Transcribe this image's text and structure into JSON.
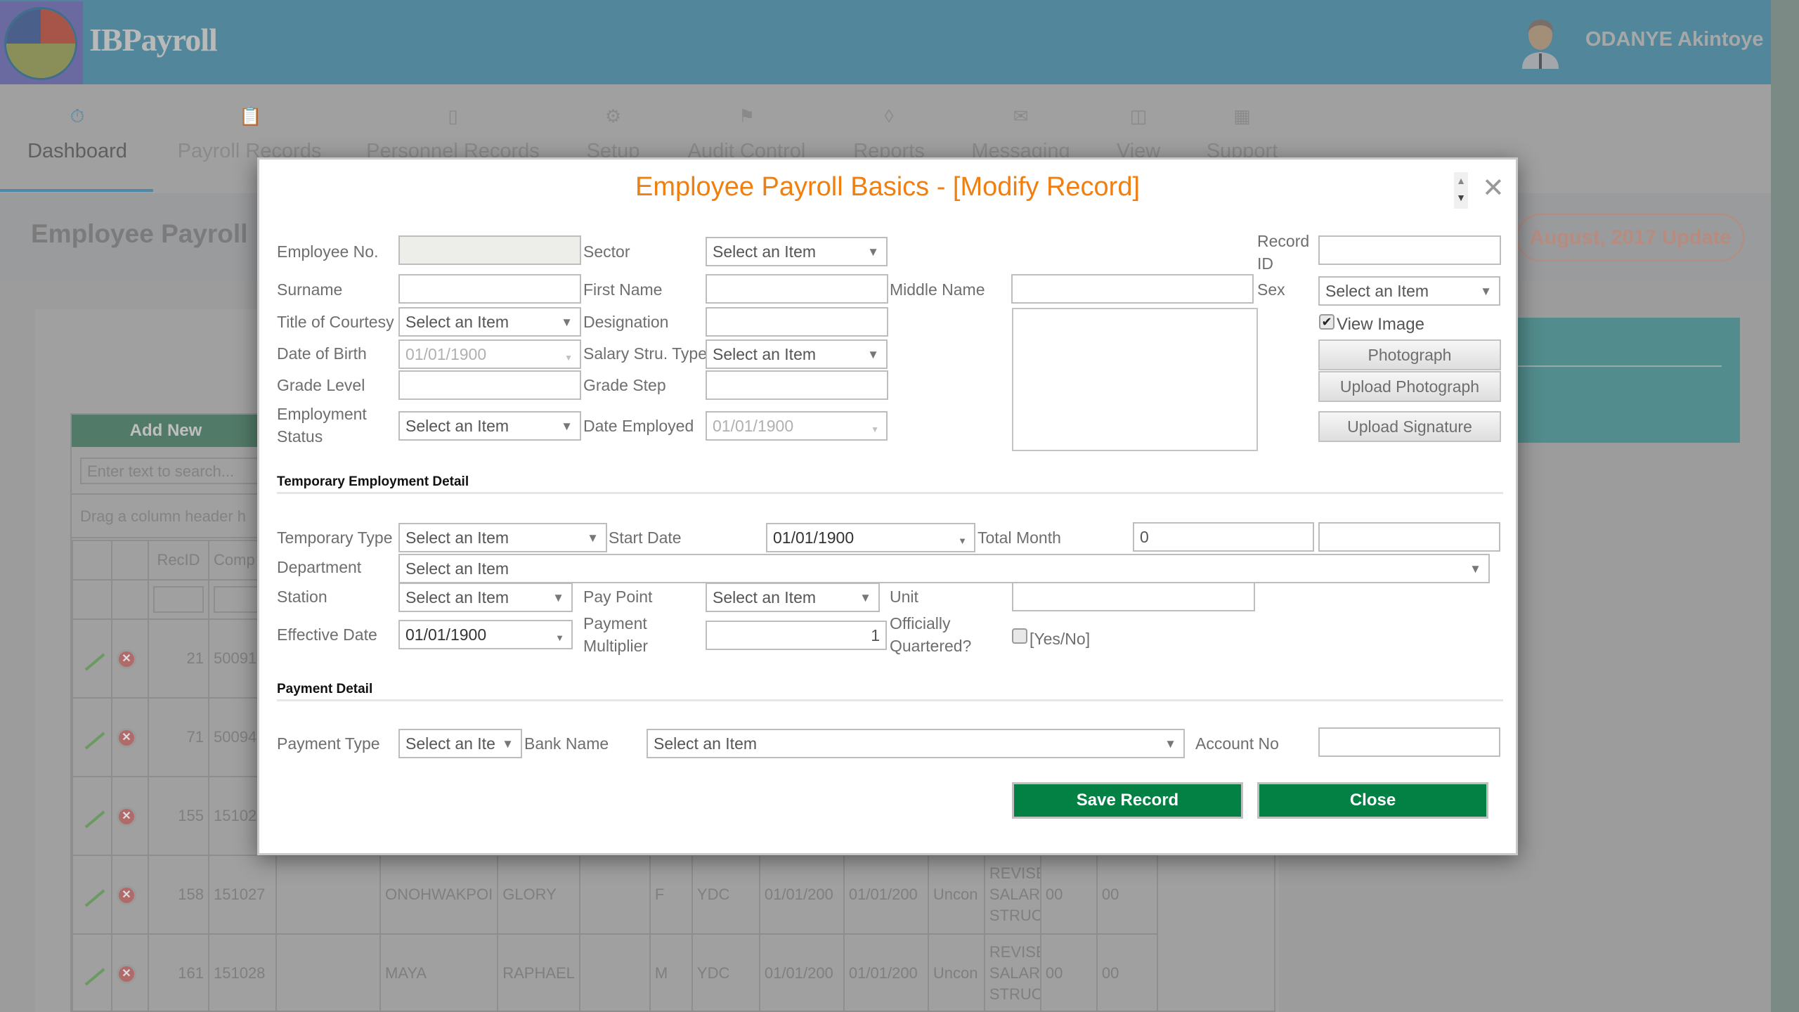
{
  "app": {
    "brand": "IBPayroll",
    "user_name": "ODANYE Akintoye"
  },
  "nav": {
    "items": [
      {
        "label": "Dashboard",
        "icon": "stopwatch-icon",
        "active": true
      },
      {
        "label": "Payroll Records",
        "icon": "clipboard-list-icon"
      },
      {
        "label": "Personnel Records",
        "icon": "clipboard-icon"
      },
      {
        "label": "Setup",
        "icon": "gear-icon"
      },
      {
        "label": "Audit Control",
        "icon": "flag-icon"
      },
      {
        "label": "Reports",
        "icon": "layers-icon"
      },
      {
        "label": "Messaging",
        "icon": "mail-icon"
      },
      {
        "label": "View",
        "icon": "columns-icon"
      },
      {
        "label": "Support",
        "icon": "network-icon"
      }
    ]
  },
  "page": {
    "title": "Employee Payroll",
    "update_badge": "August, 2017 Update"
  },
  "grid": {
    "add_new": "Add New",
    "search_placeholder": "Enter text to search...",
    "drag_hint": "Drag a column header h",
    "columns": [
      "",
      "",
      "RecID",
      "Comp"
    ],
    "rows": [
      {
        "recid": "21",
        "comp": "50091",
        "surname": "",
        "first": "",
        "sex": "",
        "code": "",
        "d1": "",
        "d2": "",
        "status": "",
        "salary": "",
        "a": "",
        "b": ""
      },
      {
        "recid": "71",
        "comp": "50094",
        "surname": "",
        "first": "",
        "sex": "",
        "code": "",
        "d1": "",
        "d2": "",
        "status": "",
        "salary": "",
        "a": "",
        "b": ""
      },
      {
        "recid": "155",
        "comp": "15102",
        "surname": "",
        "first": "",
        "sex": "",
        "code": "",
        "d1": "",
        "d2": "",
        "status": "",
        "salary": "",
        "a": "",
        "b": ""
      },
      {
        "recid": "158",
        "comp": "151027",
        "surname": "ONOHWAKPOI",
        "first": "GLORY",
        "sex": "F",
        "code": "YDC",
        "d1": "01/01/200",
        "d2": "01/01/200",
        "status": "Uncon",
        "salary": "REVISE SALAR STRUC",
        "a": "00",
        "b": "00"
      },
      {
        "recid": "161",
        "comp": "151028",
        "surname": "MAYA",
        "first": "RAPHAEL",
        "sex": "M",
        "code": "YDC",
        "d1": "01/01/200",
        "d2": "01/01/200",
        "status": "Uncon",
        "salary": "REVISE SALAR STRUC",
        "a": "00",
        "b": "00"
      }
    ]
  },
  "modal": {
    "title": "Employee Payroll Basics - [Modify Record]",
    "close_icon": "✕",
    "fields": {
      "employee_no": {
        "label": "Employee No.",
        "value": ""
      },
      "sector": {
        "label": "Sector",
        "value": "Select an Item"
      },
      "record_id": {
        "label": "Record ID",
        "value": ""
      },
      "surname": {
        "label": "Surname",
        "value": ""
      },
      "first_name": {
        "label": "First Name",
        "value": ""
      },
      "middle_name": {
        "label": "Middle Name",
        "value": ""
      },
      "sex": {
        "label": "Sex",
        "value": "Select an Item"
      },
      "title_courtesy": {
        "label": "Title of Courtesy",
        "value": "Select an Item"
      },
      "designation": {
        "label": "Designation",
        "value": ""
      },
      "view_image": {
        "label": "View Image",
        "checked": true
      },
      "date_of_birth": {
        "label": "Date of Birth",
        "value": "01/01/1900"
      },
      "salary_type": {
        "label": "Salary Stru. Type",
        "value": "Select an Item"
      },
      "grade_level": {
        "label": "Grade Level",
        "value": ""
      },
      "grade_step": {
        "label": "Grade Step",
        "value": ""
      },
      "employment_status": {
        "label": "Employment Status",
        "value": "Select an Item"
      },
      "date_employed": {
        "label": "Date Employed",
        "value": "01/01/1900"
      }
    },
    "buttons": {
      "photograph": "Photograph",
      "upload_photograph": "Upload Photograph",
      "upload_signature": "Upload Signature",
      "save": "Save Record",
      "close": "Close"
    },
    "temp_section": {
      "title": "Temporary Employment Detail",
      "temporary_type": {
        "label": "Temporary Type",
        "value": "Select an Item"
      },
      "start_date": {
        "label": "Start Date",
        "value": "01/01/1900"
      },
      "total_month": {
        "label": "Total Month",
        "value": "0",
        "extra": ""
      },
      "department": {
        "label": "Department",
        "value": "Select an Item"
      },
      "station": {
        "label": "Station",
        "value": "Select an Item"
      },
      "pay_point": {
        "label": "Pay Point",
        "value": "Select an Item"
      },
      "unit": {
        "label": "Unit",
        "value": ""
      },
      "effective_date": {
        "label": "Effective Date",
        "value": "01/01/1900"
      },
      "payment_multiplier": {
        "label": "Payment Multiplier",
        "value": "1"
      },
      "officially_quartered": {
        "label": "Officially Quartered?",
        "option": "[Yes/No]",
        "checked": false
      }
    },
    "payment_section": {
      "title": "Payment Detail",
      "payment_type": {
        "label": "Payment Type",
        "value": "Select an Ite"
      },
      "bank_name": {
        "label": "Bank Name",
        "value": "Select an Item"
      },
      "account_no": {
        "label": "Account No",
        "value": ""
      }
    }
  }
}
